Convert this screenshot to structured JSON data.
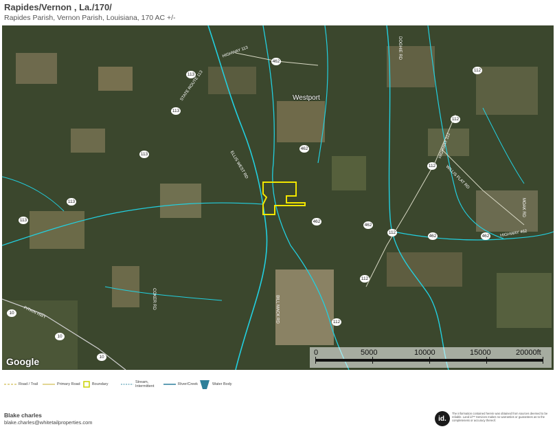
{
  "header": {
    "title": "Rapides/Vernon , La./170/",
    "subtitle": "Rapides Parish, Vernon Parish, Louisiana, 170 AC +/-"
  },
  "map": {
    "attribution": "Google",
    "place_labels": [
      "Westport"
    ],
    "road_labels": [
      "HIGHWAY 113",
      "STATE ROUTE 113",
      "ELLIS WEST RD",
      "DOGHIE RD",
      "HIGHWAY 112",
      "WILLIS FLAT RD",
      "HIGHWAY 462",
      "MOAK RD",
      "COKER RD",
      "BILL MACK RD",
      "PITKIN HWY"
    ],
    "route_shields": [
      "113",
      "462",
      "113",
      "113",
      "113",
      "113",
      "462",
      "112",
      "112",
      "112",
      "462",
      "462",
      "112",
      "462",
      "462",
      "112",
      "112",
      "10",
      "10",
      "10"
    ],
    "colors": {
      "boundary": "#f2e600",
      "river": "#22d0e0",
      "satellite_base": "#3e4a30"
    },
    "scale": {
      "labels": [
        "0",
        "5000",
        "10000",
        "15000",
        "20000ft"
      ]
    }
  },
  "legend": {
    "items": [
      {
        "label": "Road / Trail",
        "icon": "dashed-road-icon"
      },
      {
        "label": "Primary Road",
        "icon": "primary-road-icon"
      },
      {
        "label": "Boundary",
        "icon": "boundary-icon"
      },
      {
        "label": "Stream, Intermittent",
        "icon": "stream-icon"
      },
      {
        "label": "River/Creek",
        "icon": "river-icon"
      },
      {
        "label": "Water Body",
        "icon": "water-body-icon"
      }
    ]
  },
  "footer": {
    "name": "Blake charles",
    "email": "blake.charles@whitetailproperties.com",
    "logo_text": "id.",
    "disclaimer": "The information contained herein was obtained from sources deemed to be reliable. Land id™ Services makes no warranties or guarantees as to the completeness or accuracy thereof."
  }
}
